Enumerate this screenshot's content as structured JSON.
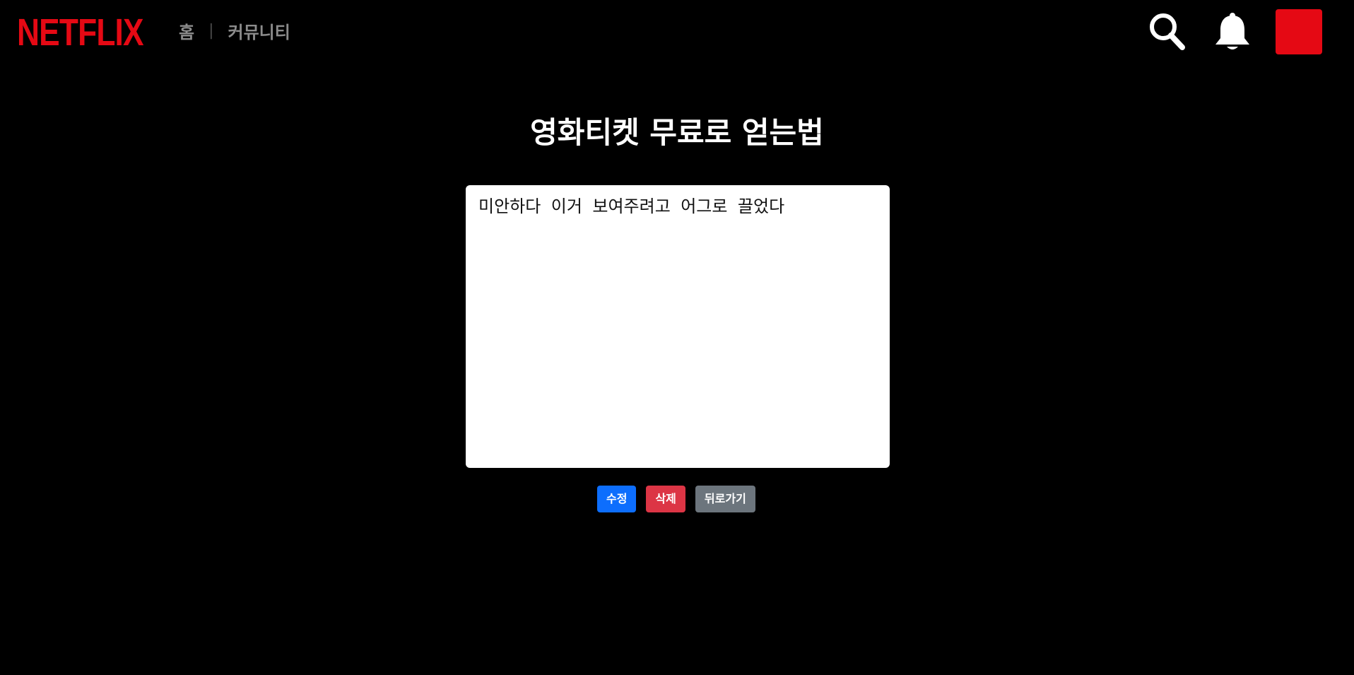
{
  "header": {
    "logo_text": "NETFLIX",
    "nav": [
      {
        "label": "홈"
      },
      {
        "label": "커뮤니티"
      }
    ],
    "nav_separator": "|",
    "icons": {
      "search": "search-icon",
      "notifications": "bell-icon"
    },
    "avatar_color": "#e50914"
  },
  "post": {
    "title": "영화티켓 무료로 얻는법",
    "body": "미안하다 이거 보여주려고 어그로 끌었다"
  },
  "actions": {
    "edit_label": "수정",
    "delete_label": "삭제",
    "back_label": "뒤로가기"
  },
  "colors": {
    "background": "#000000",
    "brand": "#e50914",
    "edit": "#0d6efd",
    "delete": "#dc3545",
    "back": "#6c757d"
  }
}
